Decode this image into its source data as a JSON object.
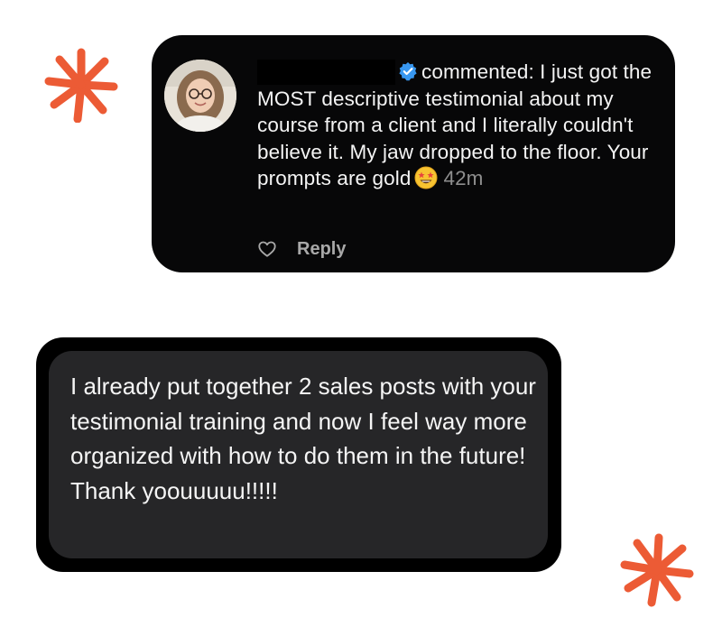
{
  "colors": {
    "accent_asterisk": "#ec5b35",
    "comment_card_bg": "#070708",
    "message_card_bg": "#000000",
    "message_bubble_bg": "#262628",
    "verified_badge": "#3897f0"
  },
  "comment": {
    "author_redacted": true,
    "text": "commented: I just got the MOST descriptive testimonial about my course from a client and I literally couldn't believe it. My jaw dropped to the floor. Your prompts are gold",
    "emoji_icon": "star-struck-emoji-icon",
    "timestamp": "42m",
    "reply_label": "Reply",
    "heart_icon": "heart-outline-icon",
    "verified_icon": "verified-badge-icon"
  },
  "message": {
    "text": "I already put together 2 sales posts with your testimonial training and now I feel way more organized with how to do them in the future! Thank yoouuuuu!!!!!"
  }
}
